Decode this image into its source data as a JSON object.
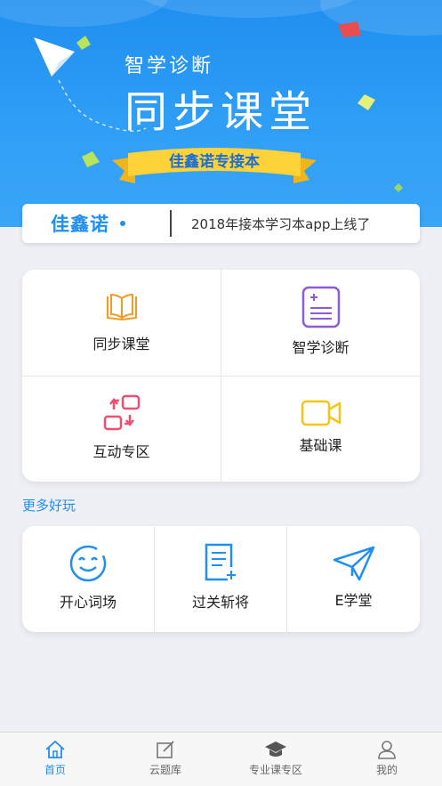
{
  "banner": {
    "subtitle": "智学诊断",
    "title": "同步课堂",
    "ribbon_text": "佳鑫诺专接本"
  },
  "notice": {
    "brand": "佳鑫诺",
    "text": "2018年接本学习本app上线了"
  },
  "main_grid": [
    {
      "label": "同步课堂",
      "icon": "open-book-icon",
      "color": "#f59a23"
    },
    {
      "label": "智学诊断",
      "icon": "notebook-plus-icon",
      "color": "#8e5ad6"
    },
    {
      "label": "互动专区",
      "icon": "swap-squares-icon",
      "color": "#f0506e"
    },
    {
      "label": "基础课",
      "icon": "video-camera-icon",
      "color": "#f5c518"
    }
  ],
  "more_section": {
    "title": "更多好玩",
    "items": [
      {
        "label": "开心词场",
        "icon": "smiley-face-icon"
      },
      {
        "label": "过关斩将",
        "icon": "document-plus-icon"
      },
      {
        "label": "E学堂",
        "icon": "paper-plane-icon"
      }
    ],
    "color": "#1f8ff0"
  },
  "tabbar": {
    "items": [
      {
        "label": "首页",
        "icon": "home-icon",
        "active": true
      },
      {
        "label": "云题库",
        "icon": "edit-icon",
        "active": false
      },
      {
        "label": "专业课专区",
        "icon": "graduation-cap-icon",
        "active": false
      },
      {
        "label": "我的",
        "icon": "user-icon",
        "active": false
      }
    ],
    "active_color": "#1f8ff0"
  }
}
